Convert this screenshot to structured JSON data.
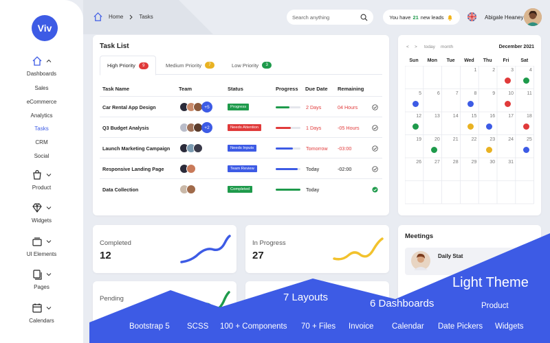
{
  "brand": {
    "logo_text": "Viv"
  },
  "sidebar": {
    "groups": [
      {
        "label": "Dashboards",
        "icon": "home-icon"
      },
      {
        "label": "Product",
        "icon": "bag-icon"
      },
      {
        "label": "Widgets",
        "icon": "diamond-icon"
      },
      {
        "label": "UI Elements",
        "icon": "layers-icon"
      },
      {
        "label": "Pages",
        "icon": "pages-icon"
      },
      {
        "label": "Calendars",
        "icon": "calendar-icon"
      }
    ],
    "subitems": [
      "Sales",
      "eCommerce",
      "Analytics",
      "Tasks",
      "CRM",
      "Social"
    ],
    "active_sub": "Tasks"
  },
  "topbar": {
    "breadcrumb": {
      "home": "Home",
      "current": "Tasks"
    },
    "search_placeholder": "Search anything",
    "leads": {
      "prefix": "You have",
      "count": "21",
      "suffix": "new leads"
    },
    "user_name": "Abigale Heaney"
  },
  "task_list": {
    "title": "Task List",
    "tabs": [
      {
        "label": "High Priority",
        "count": "9",
        "color": "#e03a3a"
      },
      {
        "label": "Medium Priority",
        "count": "7",
        "color": "#e9b222"
      },
      {
        "label": "Low Priority",
        "count": "3",
        "color": "#1e9a4b"
      }
    ],
    "columns": [
      "Task Name",
      "Team",
      "Status",
      "Progress",
      "Due Date",
      "Remaining"
    ],
    "rows": [
      {
        "name": "Car Rental App Design",
        "team_extra": "+5",
        "status": "Progress",
        "status_color": "#1e9a4b",
        "progress": 0.55,
        "progress_color": "#1e9a4b",
        "due": "2 Days",
        "due_color": "#e03a3a",
        "remaining": "04 Hours",
        "remaining_color": "#e03a3a",
        "done": false
      },
      {
        "name": "Q3 Budget Analysis",
        "team_extra": "+2",
        "status": "Needs Attention",
        "status_color": "#e03a3a",
        "progress": 0.6,
        "progress_color": "#e03a3a",
        "due": "1 Days",
        "due_color": "#e03a3a",
        "remaining": "-05 Hours",
        "remaining_color": "#e03a3a",
        "done": false
      },
      {
        "name": "Launch Marketing Campaign",
        "team_extra": "",
        "status": "Needs Inputs",
        "status_color": "#3d5be5",
        "progress": 0.7,
        "progress_color": "#3d5be5",
        "due": "Tomorrow",
        "due_color": "#e03a3a",
        "remaining": "-03:00",
        "remaining_color": "#e03a3a",
        "done": false
      },
      {
        "name": "Responsive Landing Page",
        "team_extra": "",
        "status": "Team Review",
        "status_color": "#3d5be5",
        "progress": 0.9,
        "progress_color": "#3d5be5",
        "due": "Today",
        "due_color": "#222",
        "remaining": "-02:00",
        "remaining_color": "#222",
        "done": false
      },
      {
        "name": "Data Collection",
        "team_extra": "",
        "status": "Completed",
        "status_color": "#1e9a4b",
        "progress": 1.0,
        "progress_color": "#1e9a4b",
        "due": "Today",
        "due_color": "#222",
        "remaining": "00:00",
        "remaining_color": "#222",
        "done": true
      }
    ]
  },
  "calendar": {
    "nav": [
      "<",
      ">",
      "today",
      "month"
    ],
    "month": "December 2021",
    "dow": [
      "Sun",
      "Mon",
      "Tue",
      "Wed",
      "Thu",
      "Fri",
      "Sat"
    ],
    "weeks": [
      [
        "",
        "",
        "",
        "1",
        "2",
        "3",
        "4"
      ],
      [
        "5",
        "6",
        "7",
        "8",
        "9",
        "10",
        "11"
      ],
      [
        "12",
        "13",
        "14",
        "15",
        "16",
        "17",
        "18"
      ],
      [
        "19",
        "20",
        "21",
        "22",
        "23",
        "24",
        "25"
      ],
      [
        "26",
        "27",
        "28",
        "29",
        "30",
        "31",
        ""
      ],
      [
        "",
        "",
        "",
        "",
        "",
        "",
        ""
      ]
    ],
    "events": [
      {
        "w": 0,
        "d": 5,
        "color": "#e03a3a"
      },
      {
        "w": 0,
        "d": 6,
        "color": "#1e9a4b"
      },
      {
        "w": 1,
        "d": 0,
        "color": "#3d5be5"
      },
      {
        "w": 1,
        "d": 3,
        "color": "#3d5be5"
      },
      {
        "w": 1,
        "d": 5,
        "color": "#e03a3a"
      },
      {
        "w": 2,
        "d": 0,
        "color": "#1e9a4b"
      },
      {
        "w": 2,
        "d": 3,
        "color": "#e9b222"
      },
      {
        "w": 2,
        "d": 4,
        "color": "#3d5be5"
      },
      {
        "w": 2,
        "d": 6,
        "color": "#e03a3a"
      },
      {
        "w": 3,
        "d": 1,
        "color": "#1e9a4b"
      },
      {
        "w": 3,
        "d": 4,
        "color": "#e9b222"
      },
      {
        "w": 3,
        "d": 6,
        "color": "#3d5be5"
      }
    ]
  },
  "stats": [
    {
      "label": "Completed",
      "value": "12",
      "color": "#3d5be5"
    },
    {
      "label": "In Progress",
      "value": "27",
      "color": "#f2c22d"
    },
    {
      "label": "Pending",
      "value": "",
      "color": "#1e9a4b"
    }
  ],
  "meetings": {
    "title": "Meetings",
    "item": "Daily Stat"
  },
  "banner": {
    "theme": "Light Theme",
    "layouts": "7 Layouts",
    "dashboards": "6 Dashboards",
    "product": "Product",
    "features": [
      "Bootstrap 5",
      "SCSS",
      "100 + Components",
      "70 + Files",
      "Invoice",
      "Calendar",
      "Date Pickers",
      "Widgets"
    ],
    "color": "#3d5be5"
  }
}
